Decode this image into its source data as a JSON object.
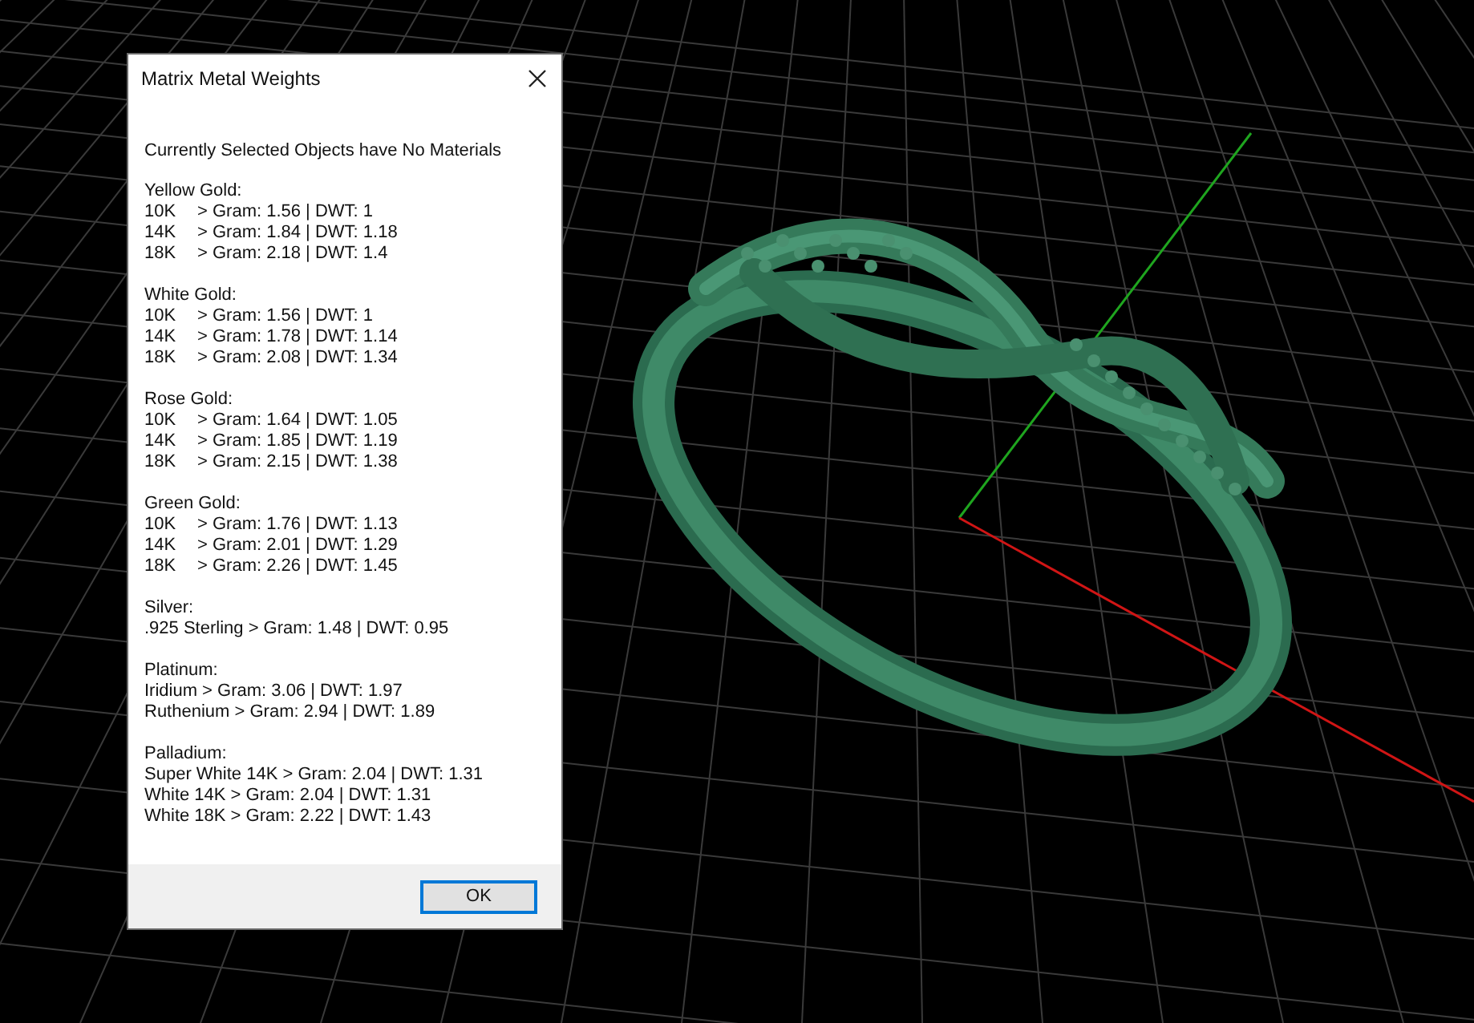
{
  "window": {
    "title": "Matrix Metal Weights"
  },
  "message": "Currently Selected Objects have No Materials",
  "sections": [
    {
      "heading": "Yellow Gold:",
      "lines": [
        {
          "kind": "grade",
          "grade": "10K",
          "reading": "> Gram: 1.56 | DWT: 1"
        },
        {
          "kind": "grade",
          "grade": "14K",
          "reading": "> Gram: 1.84 | DWT: 1.18"
        },
        {
          "kind": "grade",
          "grade": "18K",
          "reading": "> Gram: 2.18 | DWT: 1.4"
        }
      ]
    },
    {
      "heading": "White Gold:",
      "lines": [
        {
          "kind": "grade",
          "grade": "10K",
          "reading": "> Gram: 1.56 | DWT: 1"
        },
        {
          "kind": "grade",
          "grade": "14K",
          "reading": "> Gram: 1.78 | DWT: 1.14"
        },
        {
          "kind": "grade",
          "grade": "18K",
          "reading": "> Gram: 2.08 | DWT: 1.34"
        }
      ]
    },
    {
      "heading": "Rose Gold:",
      "lines": [
        {
          "kind": "grade",
          "grade": "10K",
          "reading": "> Gram: 1.64 | DWT: 1.05"
        },
        {
          "kind": "grade",
          "grade": "14K",
          "reading": "> Gram: 1.85 | DWT: 1.19"
        },
        {
          "kind": "grade",
          "grade": "18K",
          "reading": "> Gram: 2.15 | DWT: 1.38"
        }
      ]
    },
    {
      "heading": "Green Gold:",
      "lines": [
        {
          "kind": "grade",
          "grade": "10K",
          "reading": "> Gram: 1.76 | DWT: 1.13"
        },
        {
          "kind": "grade",
          "grade": "14K",
          "reading": "> Gram: 2.01 | DWT: 1.29"
        },
        {
          "kind": "grade",
          "grade": "18K",
          "reading": "> Gram: 2.26 | DWT: 1.45"
        }
      ]
    },
    {
      "heading": "Silver:",
      "lines": [
        {
          "kind": "text",
          "text": ".925 Sterling > Gram: 1.48 | DWT: 0.95"
        }
      ]
    },
    {
      "heading": "Platinum:",
      "lines": [
        {
          "kind": "text",
          "text": "Iridium > Gram: 3.06 | DWT: 1.97"
        },
        {
          "kind": "text",
          "text": "Ruthenium > Gram: 2.94 | DWT: 1.89"
        }
      ]
    },
    {
      "heading": "Palladium:",
      "lines": [
        {
          "kind": "text",
          "text": "Super White 14K > Gram: 2.04 | DWT: 1.31"
        },
        {
          "kind": "text",
          "text": "White 14K > Gram: 2.04 | DWT: 1.31"
        },
        {
          "kind": "text",
          "text": "White 18K > Gram: 2.22 | DWT: 1.43"
        }
      ]
    }
  ],
  "buttons": [
    "OK"
  ]
}
